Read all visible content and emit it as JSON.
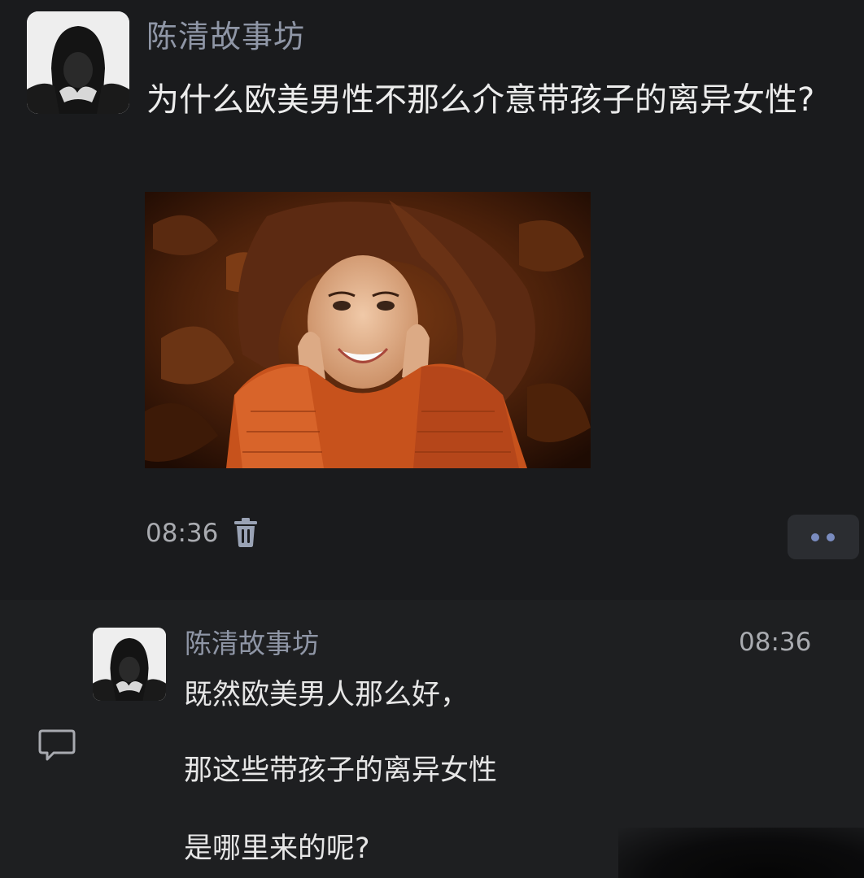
{
  "post": {
    "author": "陈清故事坊",
    "title": "为什么欧美男性不那么介意带孩子的离异女性?",
    "time": "08:36"
  },
  "comment": {
    "author": "陈清故事坊",
    "time": "08:36",
    "lines": [
      "既然欧美男人那么好，",
      "那这些带孩子的离异女性",
      "是哪里来的呢?"
    ]
  },
  "icons": {
    "delete": "trash-icon",
    "more": "more-dots-icon",
    "comment": "comment-bubble-icon"
  },
  "colors": {
    "background": "#1a1b1d",
    "author": "#8f96a6",
    "text": "#ececec",
    "accent": "#7a8cc0"
  }
}
